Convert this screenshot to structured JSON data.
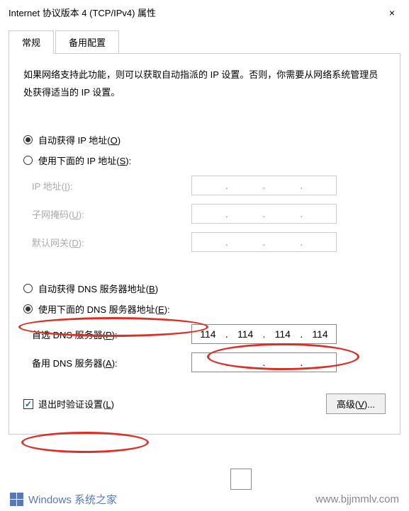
{
  "titlebar": {
    "title": "Internet 协议版本 4 (TCP/IPv4) 属性",
    "close": "×"
  },
  "tabs": {
    "general": "常规",
    "alternate": "备用配置"
  },
  "description": "如果网络支持此功能，则可以获取自动指派的 IP 设置。否则，你需要从网络系统管理员处获得适当的 IP 设置。",
  "ip": {
    "autoLabel": "自动获得 IP 地址(",
    "autoKey": "O",
    "autoTail": ")",
    "manualLabel": "使用下面的 IP 地址(",
    "manualKey": "S",
    "manualTail": "):",
    "addrLabel": "IP 地址(",
    "addrKey": "I",
    "addrTail": "):",
    "maskLabel": "子网掩码(",
    "maskKey": "U",
    "maskTail": "):",
    "gwLabel": "默认网关(",
    "gwKey": "D",
    "gwTail": "):"
  },
  "dns": {
    "autoLabel": "自动获得 DNS 服务器地址(",
    "autoKey": "B",
    "autoTail": ")",
    "manualLabel": "使用下面的 DNS 服务器地址(",
    "manualKey": "E",
    "manualTail": "):",
    "prefLabel": "首选 DNS 服务器(",
    "prefKey": "P",
    "prefTail": "):",
    "altLabel": "备用 DNS 服务器(",
    "altKey": "A",
    "altTail": "):",
    "pref": {
      "o1": "114",
      "o2": "114",
      "o3": "114",
      "o4": "114"
    }
  },
  "validate": {
    "label": "退出时验证设置(",
    "key": "L",
    "tail": ")"
  },
  "advanced": {
    "label": "高级(",
    "key": "V",
    "tail": ")..."
  },
  "dot": ".",
  "watermark": {
    "left": "Windows 系统之家",
    "right": "www.bjjmmlv.com"
  }
}
